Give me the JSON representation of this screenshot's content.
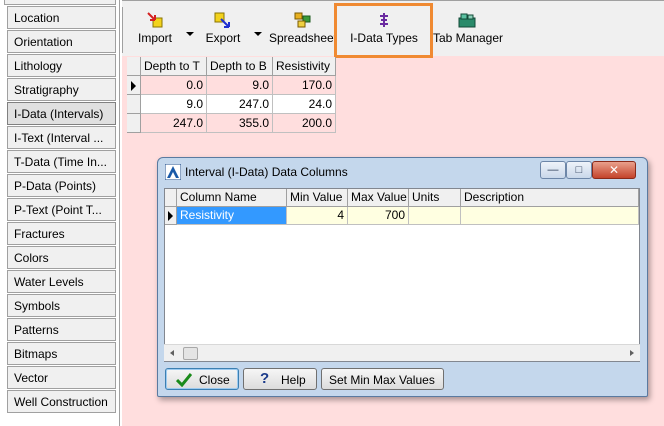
{
  "sidebar": {
    "items": [
      {
        "label": "Location"
      },
      {
        "label": "Orientation"
      },
      {
        "label": "Lithology"
      },
      {
        "label": "Stratigraphy"
      },
      {
        "label": "I-Data (Intervals)"
      },
      {
        "label": "I-Text (Interval ..."
      },
      {
        "label": "T-Data (Time In..."
      },
      {
        "label": "P-Data (Points)"
      },
      {
        "label": "P-Text (Point T..."
      },
      {
        "label": "Fractures"
      },
      {
        "label": "Colors"
      },
      {
        "label": "Water Levels"
      },
      {
        "label": "Symbols"
      },
      {
        "label": "Patterns"
      },
      {
        "label": "Bitmaps"
      },
      {
        "label": "Vector"
      },
      {
        "label": "Well Construction"
      }
    ],
    "selected_index": 4
  },
  "toolbar": {
    "import_label": "Import",
    "export_label": "Export",
    "spreadsheet_label": "Spreadsheet",
    "idata_types_label": "I-Data Types",
    "tab_manager_label": "Tab Manager",
    "highlight_color": "#f08a32"
  },
  "grid": {
    "headers": [
      "Depth to T",
      "Depth to B",
      "Resistivity"
    ],
    "rows": [
      [
        "0.0",
        "9.0",
        "170.0"
      ],
      [
        "9.0",
        "247.0",
        "24.0"
      ],
      [
        "247.0",
        "355.0",
        "200.0"
      ]
    ]
  },
  "dialog": {
    "title": "Interval (I-Data)  Data Columns",
    "headers": [
      "Column Name",
      "Min Value",
      "Max Value",
      "Units",
      "Description"
    ],
    "rows": [
      [
        "Resistivity",
        "4",
        "700",
        "",
        ""
      ]
    ],
    "close_label": "Close",
    "help_label": "Help",
    "set_min_max_label": "Set Min Max Values"
  },
  "colors": {
    "main_background": "#ffdede",
    "selected_cell": "#3399ff",
    "dialog_frame": "#c4d7ec"
  }
}
